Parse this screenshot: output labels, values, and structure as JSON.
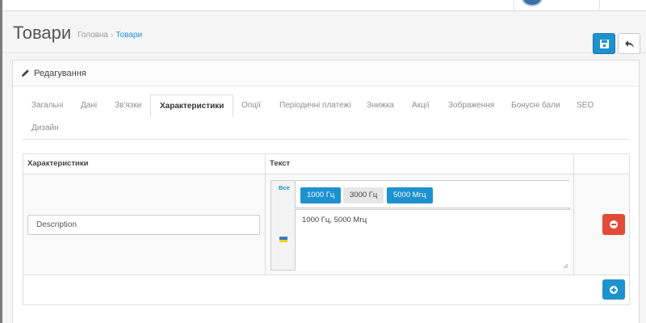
{
  "header": {
    "title": "Товари",
    "breadcrumb": [
      {
        "label": "Головна"
      },
      {
        "label": "Товари"
      }
    ],
    "breadcrumb_separator": "›",
    "save_icon": "save-icon",
    "back_icon": "reply-icon"
  },
  "panel": {
    "title": "Редагування",
    "icon": "pencil-icon"
  },
  "tabs": [
    {
      "label": "Загальні"
    },
    {
      "label": "Дані"
    },
    {
      "label": "Зв'язки"
    },
    {
      "label": "Характеристики",
      "active": true
    },
    {
      "label": "Опції"
    },
    {
      "label": "Періодичні платежі"
    },
    {
      "label": "Знижка"
    },
    {
      "label": "Акції"
    },
    {
      "label": "Зображення"
    },
    {
      "label": "Бонусні бали"
    },
    {
      "label": "SEO"
    },
    {
      "label": "Дизайн"
    }
  ],
  "table": {
    "headers": {
      "attribute": "Характеристики",
      "text": "Текст"
    },
    "rows": [
      {
        "attribute_value": "Description",
        "lang_all_label": "Все",
        "chips": [
          {
            "label": "1000 Гц",
            "selected": true
          },
          {
            "label": "3000 Гц",
            "selected": false
          },
          {
            "label": "5000 Мгц",
            "selected": true
          }
        ],
        "text_value": "1000 Гц, 5000 Мгц"
      }
    ]
  },
  "colors": {
    "primary": "#1e91cf",
    "danger": "#e04b38",
    "flag_blue": "#3b77c5",
    "flag_yellow": "#f2d21a"
  }
}
